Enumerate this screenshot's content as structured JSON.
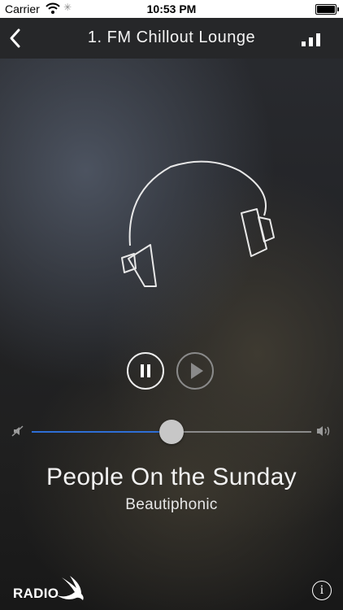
{
  "status_bar": {
    "carrier": "Carrier",
    "time": "10:53 PM",
    "battery_level": 1.0
  },
  "nav": {
    "title": "1. FM Chillout Lounge",
    "back_icon": "chevron-left-icon",
    "signal_icon": "signal-bars-icon"
  },
  "artwork_icon": "headphones-icon",
  "player": {
    "state": "paused",
    "pause_icon": "pause-icon",
    "play_icon": "play-icon",
    "volume_level": 0.5,
    "track_fill_color": "#2e6ed6"
  },
  "now_playing": {
    "title": "People On the Sunday",
    "artist": "Beautiphonic"
  },
  "footer": {
    "logo_text": "RADIO",
    "info_glyph": "i"
  }
}
